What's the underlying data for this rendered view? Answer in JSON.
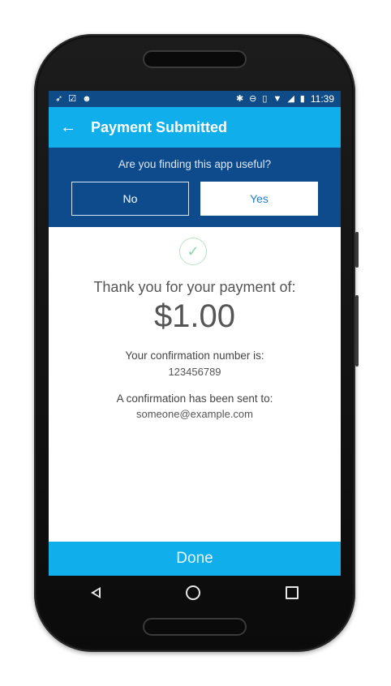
{
  "status_bar": {
    "left_icons": [
      "crossed-arrow-icon",
      "checkbox-icon",
      "android-icon"
    ],
    "right_icons": [
      "bluetooth-icon",
      "do-not-disturb-icon",
      "vibrate-icon",
      "wifi-icon",
      "signal-icon",
      "battery-icon"
    ],
    "time": "11:39"
  },
  "appbar": {
    "back_icon": "arrow-left-icon",
    "title": "Payment Submitted"
  },
  "survey": {
    "question": "Are you finding this app useful?",
    "no_label": "No",
    "yes_label": "Yes"
  },
  "confirmation": {
    "thanks_text": "Thank you for your payment of:",
    "amount": "$1.00",
    "confirmation_label": "Your confirmation number is:",
    "confirmation_number": "123456789",
    "sent_label": "A confirmation has been sent to:",
    "email": "someone@example.com"
  },
  "done_label": "Done",
  "colors": {
    "appbar": "#10aeea",
    "status_bar": "#0f4b86",
    "survey_bg": "#0e4b8c",
    "done_bg": "#10aeea",
    "check": "#96d3aa"
  }
}
